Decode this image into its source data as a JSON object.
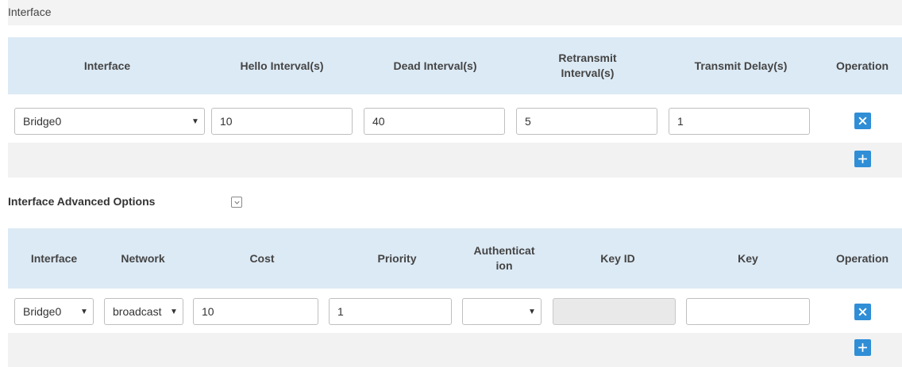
{
  "section1": {
    "title": "Interface",
    "headers": [
      "Interface",
      "Hello Interval(s)",
      "Dead Interval(s)",
      "Retransmit\nInterval(s)",
      "Transmit Delay(s)",
      "Operation"
    ],
    "row": {
      "interface": "Bridge0",
      "hello_interval": "10",
      "dead_interval": "40",
      "retransmit_interval": "5",
      "transmit_delay": "1"
    }
  },
  "section2": {
    "title": "Interface Advanced Options",
    "headers": [
      "Interface",
      "Network",
      "Cost",
      "Priority",
      "Authenticat\nion",
      "Key ID",
      "Key",
      "Operation"
    ],
    "row": {
      "interface": "Bridge0",
      "network": "broadcast",
      "cost": "10",
      "priority": "1",
      "authentication": "",
      "key_id": "",
      "key": ""
    }
  },
  "icons": {
    "dropdown": "chevron-down-icon",
    "delete": "close-icon",
    "add": "plus-icon",
    "collapse": "collapse-toggle-icon"
  },
  "colors": {
    "header_bg": "#dceaf5",
    "button_blue": "#2f8ed6",
    "row_alt_bg": "#f2f2f2"
  }
}
